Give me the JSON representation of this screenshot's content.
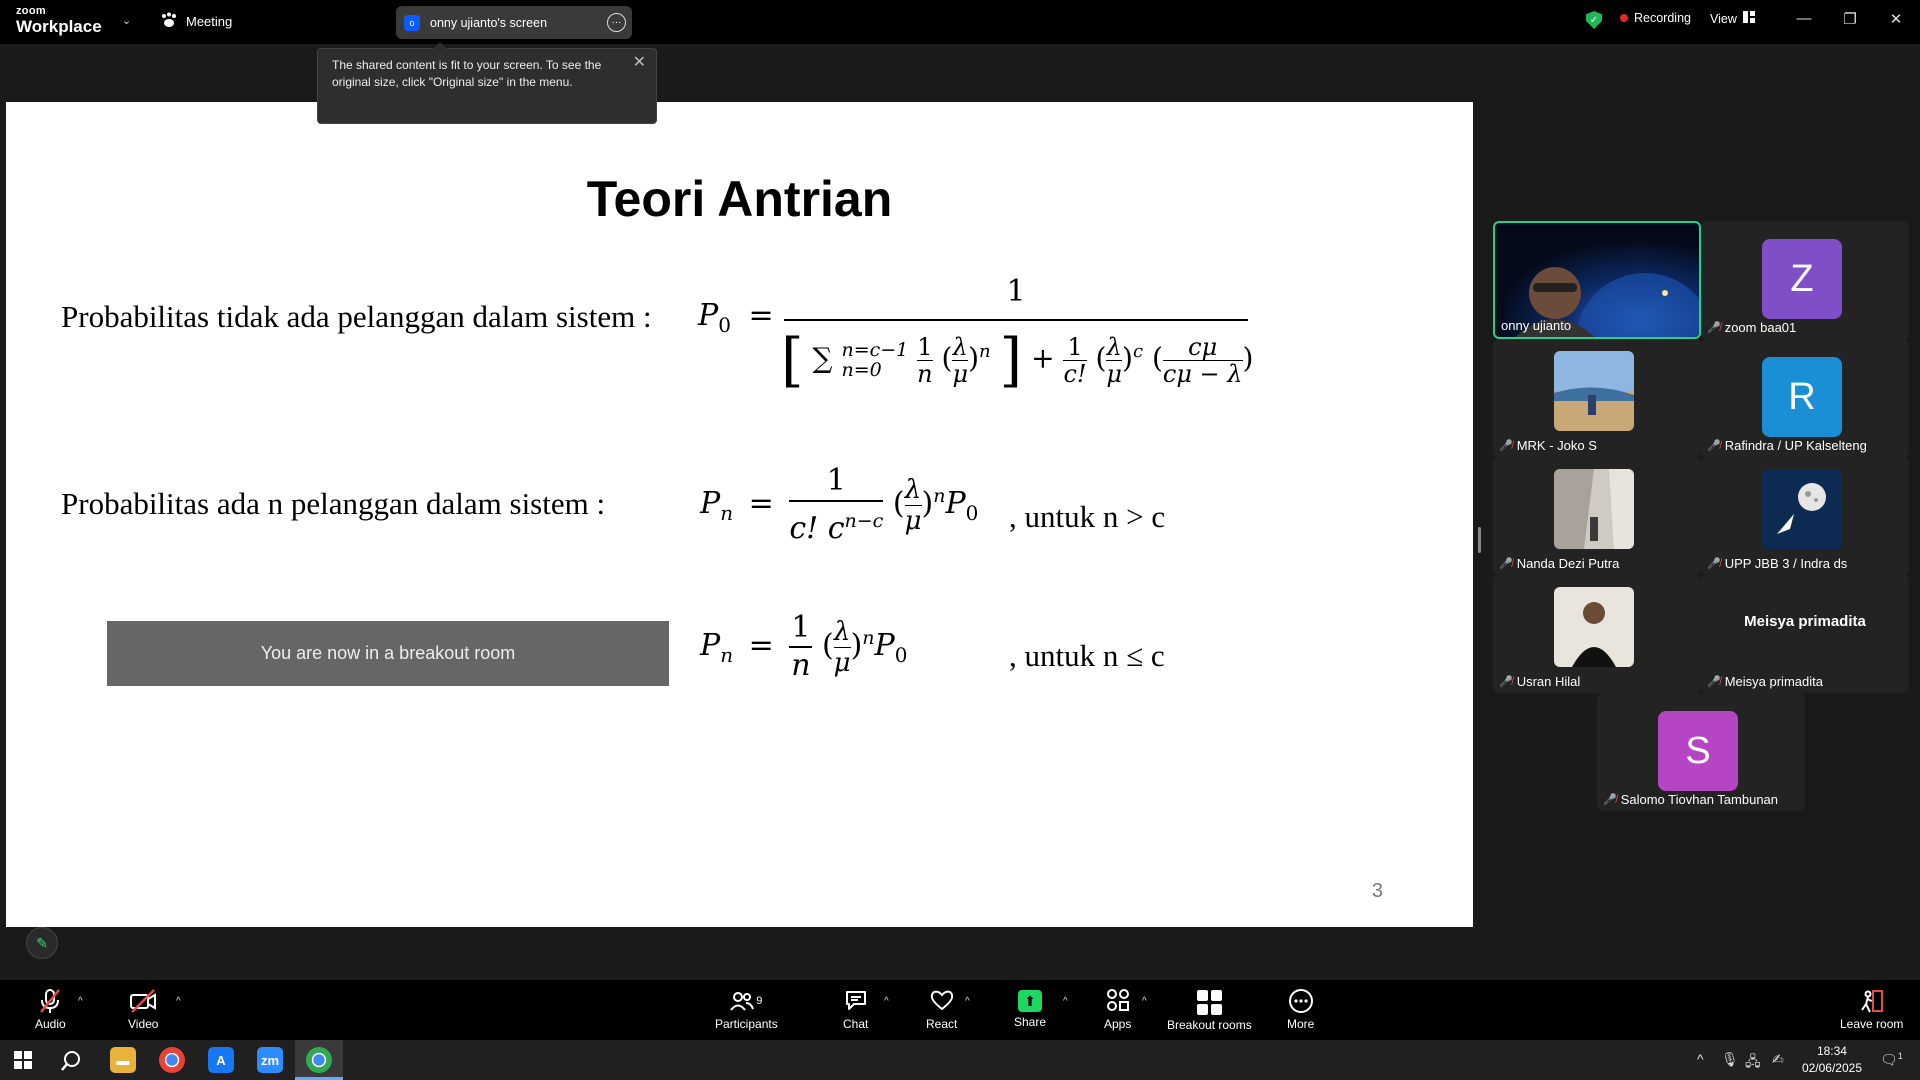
{
  "app": {
    "logo_small": "zoom",
    "logo_big": "Workplace",
    "meeting_label": "Meeting",
    "share_indicator": "onny ujianto's screen",
    "share_badge": "o",
    "recording_label": "Recording",
    "view_label": "View"
  },
  "tooltip": {
    "text": "The shared content is fit to your screen. To see the original size, click \"Original size\" in the menu."
  },
  "slide": {
    "title": "Teori Antrian",
    "label_p0": "Probabilitas tidak ada pelanggan dalam sistem :",
    "label_pn": "Probabilitas ada n pelanggan dalam sistem :",
    "cond_gt": ", untuk n > c",
    "cond_le": ", untuk n ≤ c",
    "breakout_notice": "You are now in a breakout room",
    "page_number": "3",
    "formula": {
      "p0_lhs_sym": "P",
      "p0_lhs_sub": "0",
      "one": "1",
      "sum_sym": "∑",
      "sum_upper": "n=c−1",
      "sum_lower": "n=0",
      "n": "n",
      "c": "c",
      "lambda": "λ",
      "mu": "μ",
      "c_mu": "cμ",
      "c_mu_minus_lambda": "cμ − λ",
      "c_fact": "c!",
      "c_fact_c_pow": "c! c",
      "pow_n_minus_c": "n−c",
      "pn_lhs_sym": "P",
      "pn_lhs_sub": "n",
      "p0": "P",
      "p0_sub": "0"
    }
  },
  "participants": [
    {
      "name": "onny ujianto",
      "kind": "video",
      "muted": false,
      "active": true
    },
    {
      "name": "zoom baa01",
      "kind": "avatar",
      "initial": "Z",
      "color": "#7e4fc7",
      "muted": true
    },
    {
      "name": "MRK - Joko S",
      "kind": "photo",
      "muted": true
    },
    {
      "name": "Rafindra / UP Kalselteng",
      "kind": "avatar",
      "initial": "R",
      "color": "#1a8fd6",
      "muted": true
    },
    {
      "name": "Nanda Dezi Putra",
      "kind": "photo",
      "muted": true
    },
    {
      "name": "UPP JBB 3 / Indra ds",
      "kind": "photo",
      "muted": true
    },
    {
      "name": "Usran Hilal",
      "kind": "photo",
      "muted": true
    },
    {
      "name": "Meisya primadita",
      "kind": "text",
      "display": "Meisya primadita",
      "muted": true
    },
    {
      "name": "Salomo Tiovhan Tambunan",
      "kind": "avatar",
      "initial": "S",
      "color": "#b545c4",
      "muted": true
    }
  ],
  "toolbar": {
    "audio": "Audio",
    "video": "Video",
    "participants": "Participants",
    "participants_count": "9",
    "chat": "Chat",
    "react": "React",
    "share": "Share",
    "apps": "Apps",
    "breakout": "Breakout rooms",
    "more": "More",
    "leave": "Leave room"
  },
  "taskbar": {
    "time": "18:34",
    "date": "02/06/2025",
    "notif_count": "1",
    "zoom_icon_text": "zm"
  },
  "colors": {
    "accent_green": "#23d18b",
    "recording_red": "#e02828",
    "zoom_blue": "#0b5cff"
  }
}
